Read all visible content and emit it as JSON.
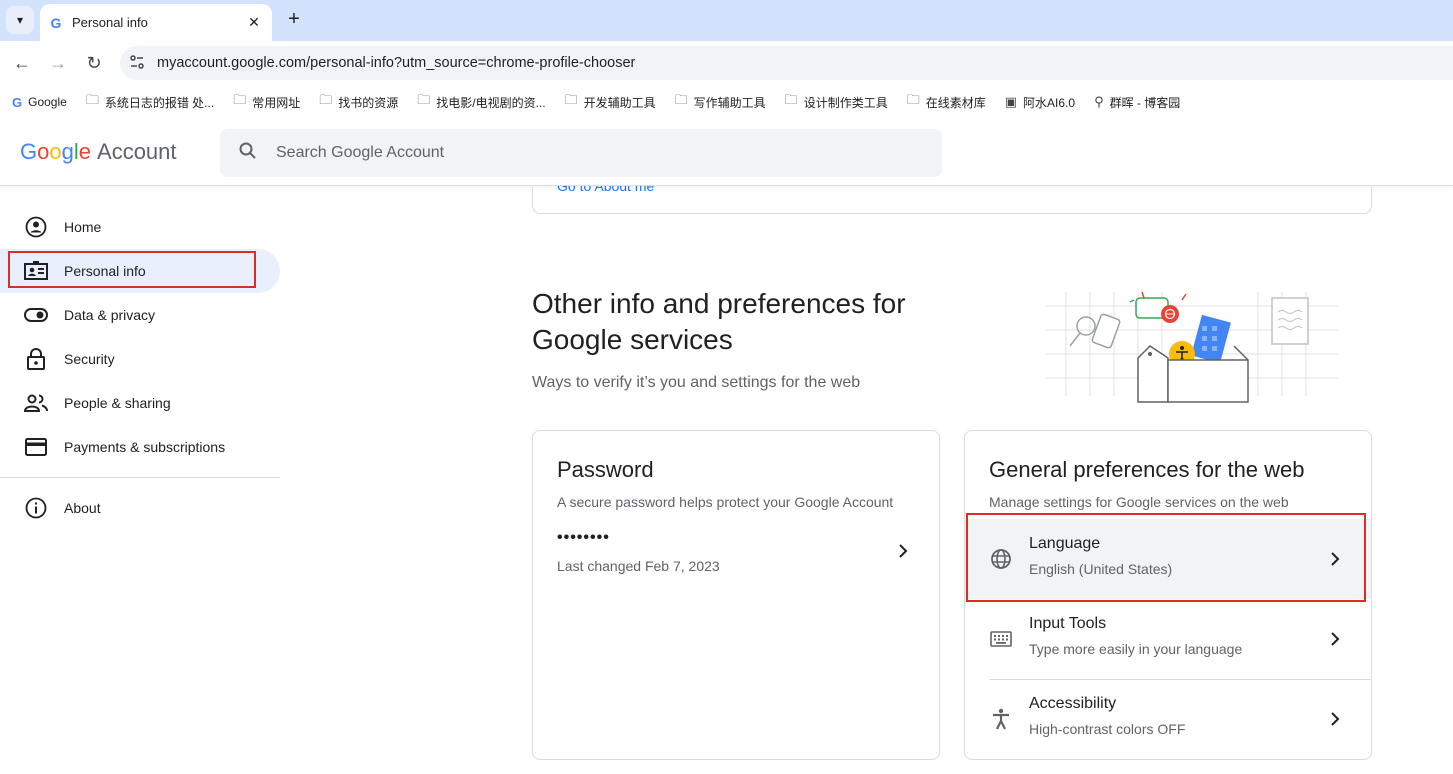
{
  "browser": {
    "tab_title": "Personal info",
    "tab_favicon": "G",
    "url": "myaccount.google.com/personal-info?utm_source=chrome-profile-chooser"
  },
  "bookmarks": [
    {
      "label": "Google",
      "icon": "google-icon"
    },
    {
      "label": "系统日志的报错 处...",
      "icon": "folder-icon"
    },
    {
      "label": "常用网址",
      "icon": "folder-icon"
    },
    {
      "label": "找书的资源",
      "icon": "folder-icon"
    },
    {
      "label": "找电影/电视剧的资...",
      "icon": "folder-icon"
    },
    {
      "label": "开发辅助工具",
      "icon": "folder-icon"
    },
    {
      "label": "写作辅助工具",
      "icon": "folder-icon"
    },
    {
      "label": "设计制作类工具",
      "icon": "folder-icon"
    },
    {
      "label": "在线素材库",
      "icon": "folder-icon"
    },
    {
      "label": "阿水AI6.0",
      "icon": "app-icon"
    },
    {
      "label": "群晖 - 博客园",
      "icon": "page-icon"
    }
  ],
  "header": {
    "logo_google": [
      "G",
      "o",
      "o",
      "g",
      "l",
      "e"
    ],
    "logo_account": "Account",
    "search_placeholder": "Search Google Account"
  },
  "sidebar": {
    "items": [
      {
        "label": "Home",
        "icon": "home-icon"
      },
      {
        "label": "Personal info",
        "icon": "personal-info-icon",
        "active": true
      },
      {
        "label": "Data & privacy",
        "icon": "toggle-icon"
      },
      {
        "label": "Security",
        "icon": "lock-icon"
      },
      {
        "label": "People & sharing",
        "icon": "people-icon"
      },
      {
        "label": "Payments & subscriptions",
        "icon": "card-icon"
      }
    ],
    "about": "About"
  },
  "main": {
    "top_link": "Go to About me",
    "section_title": "Other info and preferences for Google services",
    "section_subtitle": "Ways to verify it’s you and settings for the web",
    "password_card": {
      "title": "Password",
      "description": "A secure password helps protect your Google Account",
      "masked": "••••••••",
      "last_changed": "Last changed Feb 7, 2023"
    },
    "prefs_card": {
      "title": "General preferences for the web",
      "description": "Manage settings for Google services on the web",
      "rows": [
        {
          "title": "Language",
          "subtitle": "English (United States)",
          "icon": "globe-icon"
        },
        {
          "title": "Input Tools",
          "subtitle": "Type more easily in your language",
          "icon": "keyboard-icon"
        },
        {
          "title": "Accessibility",
          "subtitle": "High-contrast colors OFF",
          "icon": "accessibility-icon"
        }
      ]
    }
  },
  "colors": {
    "accent": "#1a73e8",
    "active_nav": "#e8f0fe",
    "highlight": "#d93025"
  }
}
